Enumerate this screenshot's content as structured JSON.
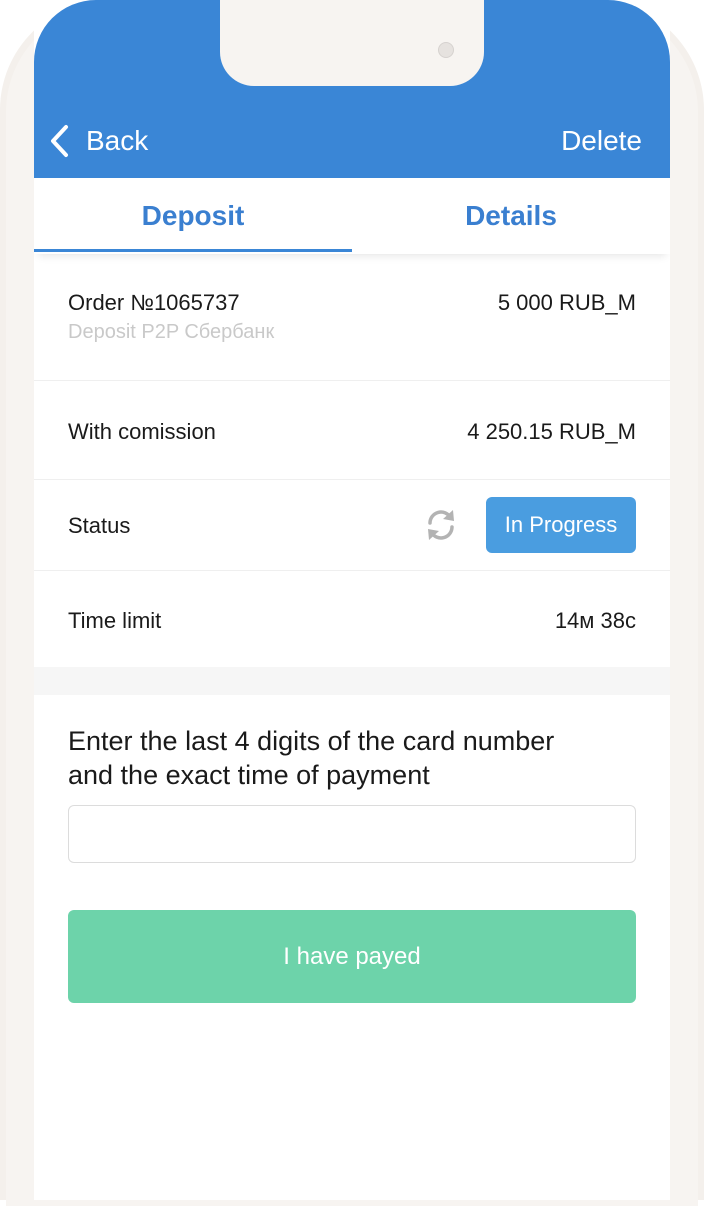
{
  "header": {
    "back_label": "Back",
    "delete_label": "Delete",
    "background": "#3a86d6"
  },
  "tabs": [
    {
      "label": "Deposit",
      "active": true
    },
    {
      "label": "Details",
      "active": false
    }
  ],
  "order": {
    "title": "Order №1065737",
    "method": "Deposit P2P Сбербанк",
    "amount": "5 000 RUB_M"
  },
  "commission": {
    "label": "With comission",
    "value": "4 250.15 RUB_M"
  },
  "status": {
    "label": "Status",
    "refresh_icon": "refresh-icon",
    "value": "In Progress",
    "badge_color": "#4a9de0"
  },
  "time_limit": {
    "label": "Time limit",
    "value": "14м 38с"
  },
  "payment_form": {
    "prompt_line1": "Enter the last 4 digits of the card number",
    "prompt_line2": "and the exact time of payment",
    "input_value": "",
    "input_placeholder": "",
    "submit_label": "I have payed",
    "submit_color": "#6dd3aa"
  }
}
